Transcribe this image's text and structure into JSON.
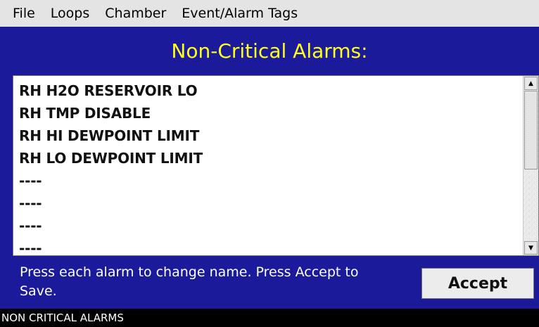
{
  "menu": {
    "items": [
      "File",
      "Loops",
      "Chamber",
      "Event/Alarm Tags"
    ]
  },
  "screen": {
    "title": "Non-Critical Alarms:"
  },
  "alarms": {
    "items": [
      "RH H2O RESERVOIR LO",
      "RH TMP DISABLE",
      "RH HI DEWPOINT LIMIT",
      "RH LO DEWPOINT LIMIT",
      "----",
      "----",
      "----",
      "----"
    ]
  },
  "footer": {
    "instructions": "Press each alarm to change name. Press Accept to Save.",
    "accept_label": "Accept"
  },
  "status": {
    "text": "NON CRITICAL ALARMS"
  },
  "colors": {
    "background": "#1a1a9a",
    "title": "#ffff1e",
    "status_bar": "#000000"
  }
}
